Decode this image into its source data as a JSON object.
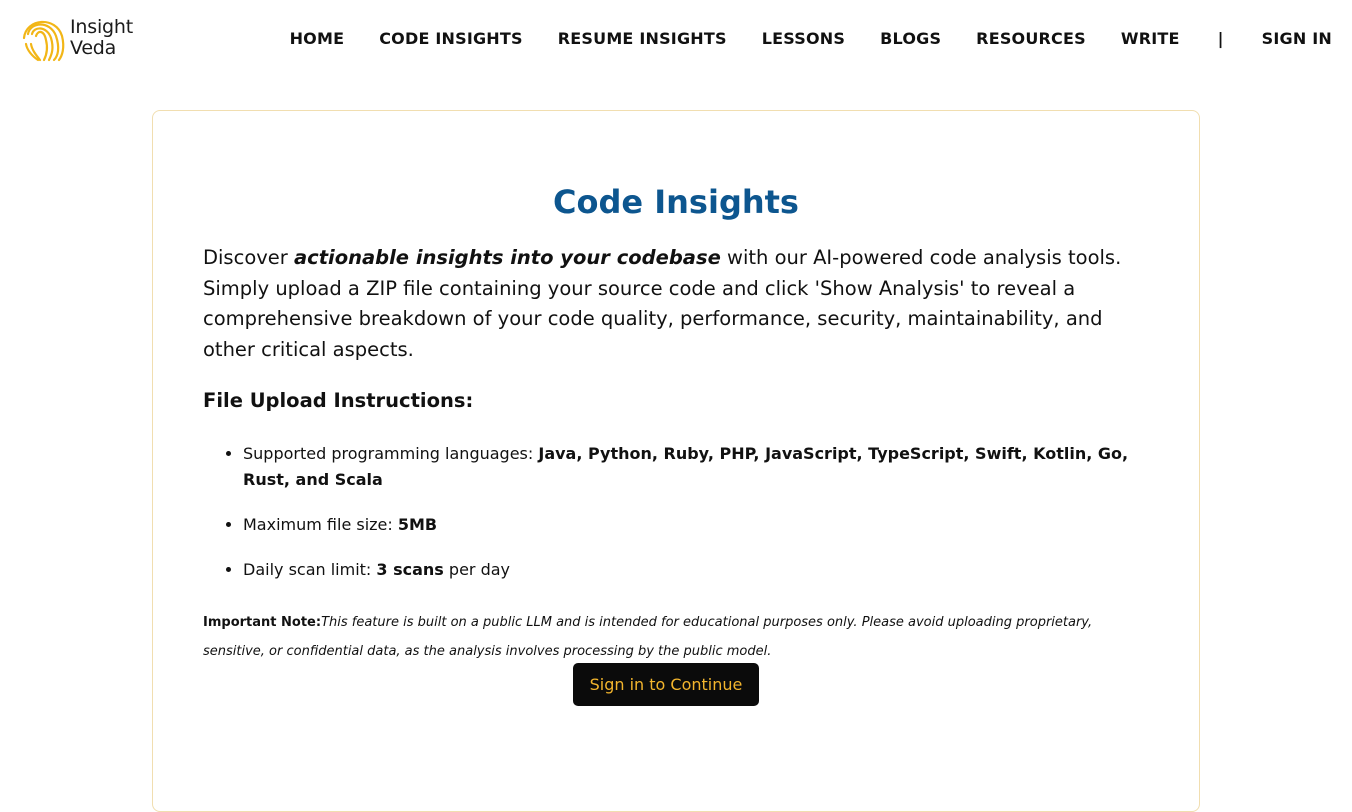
{
  "brand": {
    "line1": "Insight",
    "line2": "Veda",
    "accent": "#f2b617"
  },
  "nav": {
    "items": [
      "HOME",
      "CODE INSIGHTS",
      "RESUME INSIGHTS",
      "LESSONS",
      "BLOGS",
      "RESOURCES",
      "WRITE"
    ],
    "separator": "|",
    "sign_in": "SIGN IN"
  },
  "main": {
    "title": "Code Insights",
    "intro_prefix": "Discover ",
    "intro_emphasis": "actionable insights into your codebase",
    "intro_suffix": " with our AI-powered code analysis tools. Simply upload a ZIP file containing your source code and click 'Show Analysis' to reveal a comprehensive breakdown of your code quality, performance, security, maintainability, and other critical aspects.",
    "instructions_title": "File Upload Instructions:",
    "instructions": [
      {
        "label": "Supported programming languages: ",
        "value": "Java, Python, Ruby, PHP, JavaScript, TypeScript, Swift, Kotlin, Go, Rust, and Scala",
        "suffix": ""
      },
      {
        "label": "Maximum file size: ",
        "value": "5MB",
        "suffix": ""
      },
      {
        "label": "Daily scan limit: ",
        "value": "3 scans",
        "suffix": " per day"
      }
    ],
    "note_label": "Important Note:",
    "note_text": "This feature is built on a public LLM and is intended for educational purposes only. Please avoid uploading proprietary, sensitive, or confidential data, as the analysis involves processing by the public model.",
    "cta_label": "Sign in to Continue"
  },
  "colors": {
    "title": "#0d568f",
    "button_bg": "#0b0b0b",
    "button_text": "#f3b52d",
    "card_border": "#f1deb0"
  }
}
